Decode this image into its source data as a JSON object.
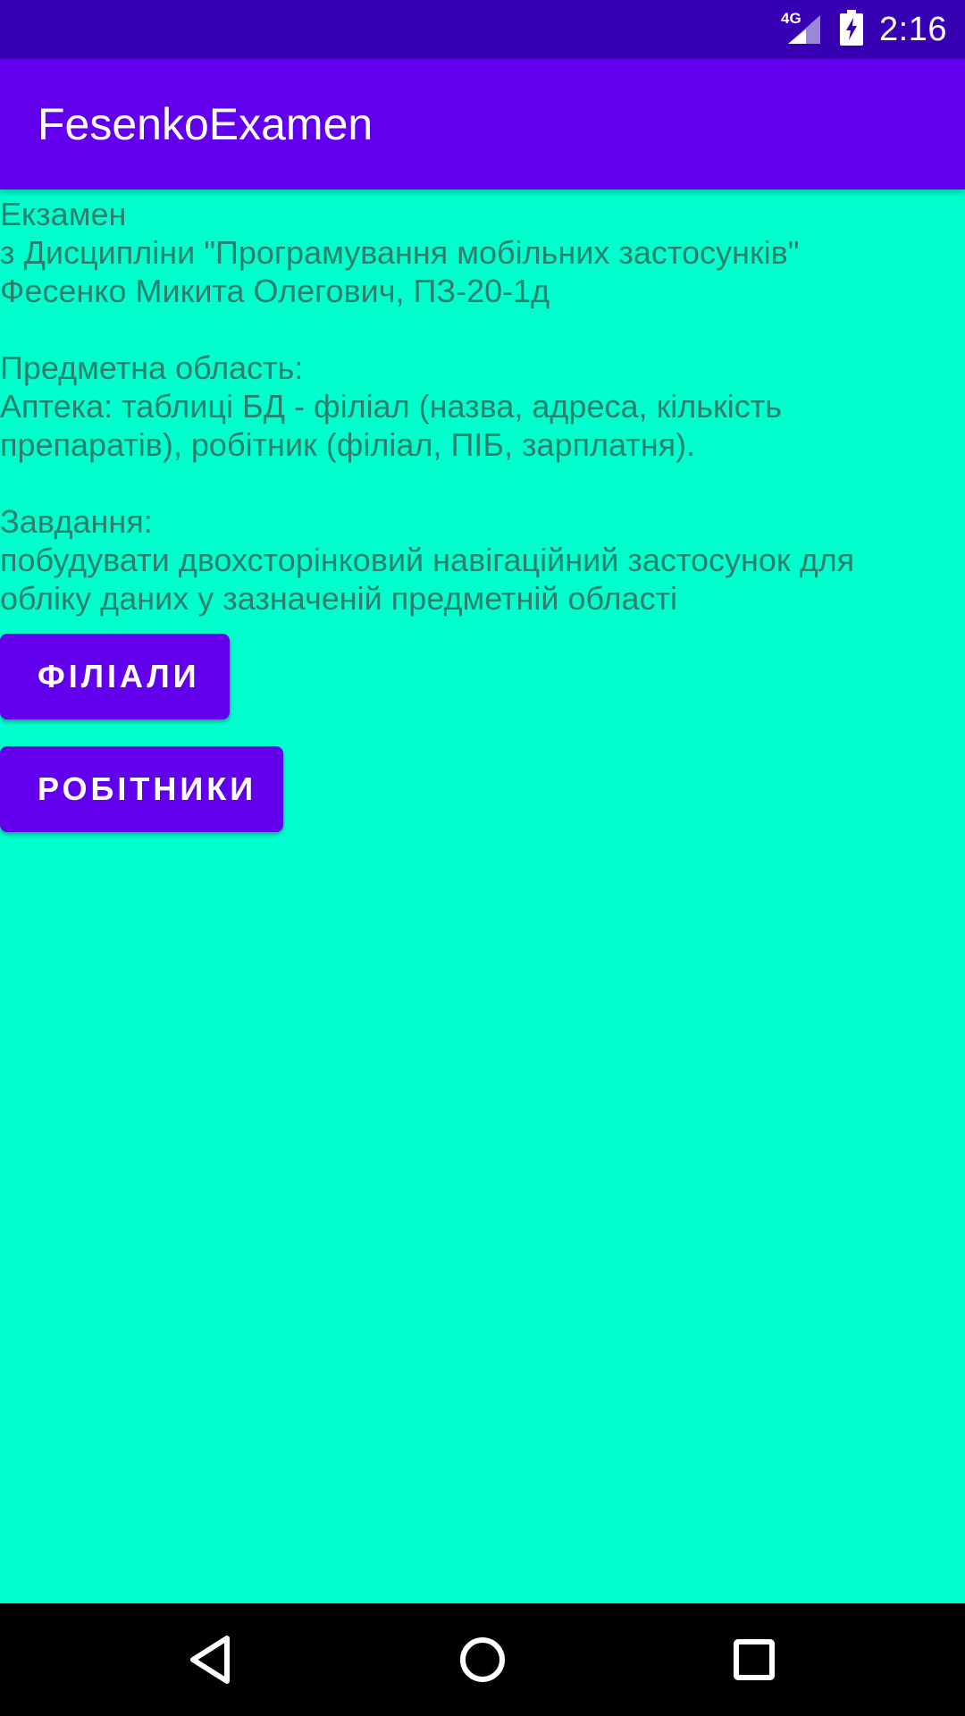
{
  "status_bar": {
    "network_label": "4G",
    "time": "2:16",
    "icons": [
      "signal-icon",
      "battery-charging-icon"
    ]
  },
  "app_bar": {
    "title": "FesenkoExamen"
  },
  "main": {
    "intro_text": "Екзамен\nз Дисципліни \"Програмування мобільних застосунків\"\nФесенко Микита Олегович, ПЗ-20-1д\n\nПредметна область:\nАптека: таблиці БД - філіал (назва, адреса, кількість препаратів), робітник (філіал, ПІБ, зарплатня).\n\nЗавдання:\nпобудувати двохсторінковий навігаційний застосунок для обліку даних у зазначеній предметній області",
    "buttons": {
      "branches_label": "ФІЛІАЛИ",
      "workers_label": "РОБІТНИКИ"
    }
  },
  "nav_bar": {
    "icons": [
      "back-icon",
      "home-icon",
      "recent-apps-icon"
    ]
  },
  "colors": {
    "background": "#00FFCC",
    "status_bar": "#3700B3",
    "app_bar": "#6200EE",
    "button": "#6200EE",
    "text": "#2B7F6E"
  }
}
